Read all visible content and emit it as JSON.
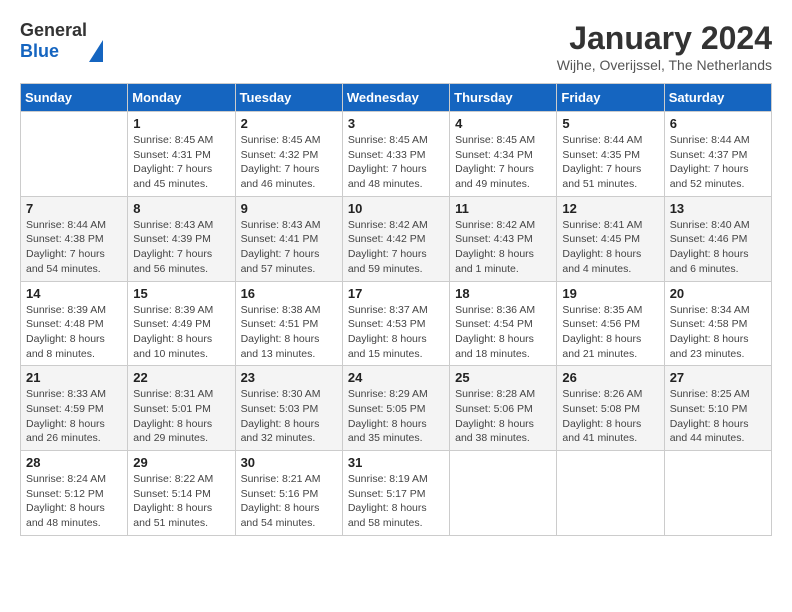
{
  "header": {
    "logo": {
      "general": "General",
      "blue": "Blue"
    },
    "title": "January 2024",
    "location": "Wijhe, Overijssel, The Netherlands"
  },
  "calendar": {
    "days_of_week": [
      "Sunday",
      "Monday",
      "Tuesday",
      "Wednesday",
      "Thursday",
      "Friday",
      "Saturday"
    ],
    "weeks": [
      [
        {
          "day": "",
          "info": ""
        },
        {
          "day": "1",
          "info": "Sunrise: 8:45 AM\nSunset: 4:31 PM\nDaylight: 7 hours\nand 45 minutes."
        },
        {
          "day": "2",
          "info": "Sunrise: 8:45 AM\nSunset: 4:32 PM\nDaylight: 7 hours\nand 46 minutes."
        },
        {
          "day": "3",
          "info": "Sunrise: 8:45 AM\nSunset: 4:33 PM\nDaylight: 7 hours\nand 48 minutes."
        },
        {
          "day": "4",
          "info": "Sunrise: 8:45 AM\nSunset: 4:34 PM\nDaylight: 7 hours\nand 49 minutes."
        },
        {
          "day": "5",
          "info": "Sunrise: 8:44 AM\nSunset: 4:35 PM\nDaylight: 7 hours\nand 51 minutes."
        },
        {
          "day": "6",
          "info": "Sunrise: 8:44 AM\nSunset: 4:37 PM\nDaylight: 7 hours\nand 52 minutes."
        }
      ],
      [
        {
          "day": "7",
          "info": "Sunrise: 8:44 AM\nSunset: 4:38 PM\nDaylight: 7 hours\nand 54 minutes."
        },
        {
          "day": "8",
          "info": "Sunrise: 8:43 AM\nSunset: 4:39 PM\nDaylight: 7 hours\nand 56 minutes."
        },
        {
          "day": "9",
          "info": "Sunrise: 8:43 AM\nSunset: 4:41 PM\nDaylight: 7 hours\nand 57 minutes."
        },
        {
          "day": "10",
          "info": "Sunrise: 8:42 AM\nSunset: 4:42 PM\nDaylight: 7 hours\nand 59 minutes."
        },
        {
          "day": "11",
          "info": "Sunrise: 8:42 AM\nSunset: 4:43 PM\nDaylight: 8 hours\nand 1 minute."
        },
        {
          "day": "12",
          "info": "Sunrise: 8:41 AM\nSunset: 4:45 PM\nDaylight: 8 hours\nand 4 minutes."
        },
        {
          "day": "13",
          "info": "Sunrise: 8:40 AM\nSunset: 4:46 PM\nDaylight: 8 hours\nand 6 minutes."
        }
      ],
      [
        {
          "day": "14",
          "info": "Sunrise: 8:39 AM\nSunset: 4:48 PM\nDaylight: 8 hours\nand 8 minutes."
        },
        {
          "day": "15",
          "info": "Sunrise: 8:39 AM\nSunset: 4:49 PM\nDaylight: 8 hours\nand 10 minutes."
        },
        {
          "day": "16",
          "info": "Sunrise: 8:38 AM\nSunset: 4:51 PM\nDaylight: 8 hours\nand 13 minutes."
        },
        {
          "day": "17",
          "info": "Sunrise: 8:37 AM\nSunset: 4:53 PM\nDaylight: 8 hours\nand 15 minutes."
        },
        {
          "day": "18",
          "info": "Sunrise: 8:36 AM\nSunset: 4:54 PM\nDaylight: 8 hours\nand 18 minutes."
        },
        {
          "day": "19",
          "info": "Sunrise: 8:35 AM\nSunset: 4:56 PM\nDaylight: 8 hours\nand 21 minutes."
        },
        {
          "day": "20",
          "info": "Sunrise: 8:34 AM\nSunset: 4:58 PM\nDaylight: 8 hours\nand 23 minutes."
        }
      ],
      [
        {
          "day": "21",
          "info": "Sunrise: 8:33 AM\nSunset: 4:59 PM\nDaylight: 8 hours\nand 26 minutes."
        },
        {
          "day": "22",
          "info": "Sunrise: 8:31 AM\nSunset: 5:01 PM\nDaylight: 8 hours\nand 29 minutes."
        },
        {
          "day": "23",
          "info": "Sunrise: 8:30 AM\nSunset: 5:03 PM\nDaylight: 8 hours\nand 32 minutes."
        },
        {
          "day": "24",
          "info": "Sunrise: 8:29 AM\nSunset: 5:05 PM\nDaylight: 8 hours\nand 35 minutes."
        },
        {
          "day": "25",
          "info": "Sunrise: 8:28 AM\nSunset: 5:06 PM\nDaylight: 8 hours\nand 38 minutes."
        },
        {
          "day": "26",
          "info": "Sunrise: 8:26 AM\nSunset: 5:08 PM\nDaylight: 8 hours\nand 41 minutes."
        },
        {
          "day": "27",
          "info": "Sunrise: 8:25 AM\nSunset: 5:10 PM\nDaylight: 8 hours\nand 44 minutes."
        }
      ],
      [
        {
          "day": "28",
          "info": "Sunrise: 8:24 AM\nSunset: 5:12 PM\nDaylight: 8 hours\nand 48 minutes."
        },
        {
          "day": "29",
          "info": "Sunrise: 8:22 AM\nSunset: 5:14 PM\nDaylight: 8 hours\nand 51 minutes."
        },
        {
          "day": "30",
          "info": "Sunrise: 8:21 AM\nSunset: 5:16 PM\nDaylight: 8 hours\nand 54 minutes."
        },
        {
          "day": "31",
          "info": "Sunrise: 8:19 AM\nSunset: 5:17 PM\nDaylight: 8 hours\nand 58 minutes."
        },
        {
          "day": "",
          "info": ""
        },
        {
          "day": "",
          "info": ""
        },
        {
          "day": "",
          "info": ""
        }
      ]
    ]
  }
}
